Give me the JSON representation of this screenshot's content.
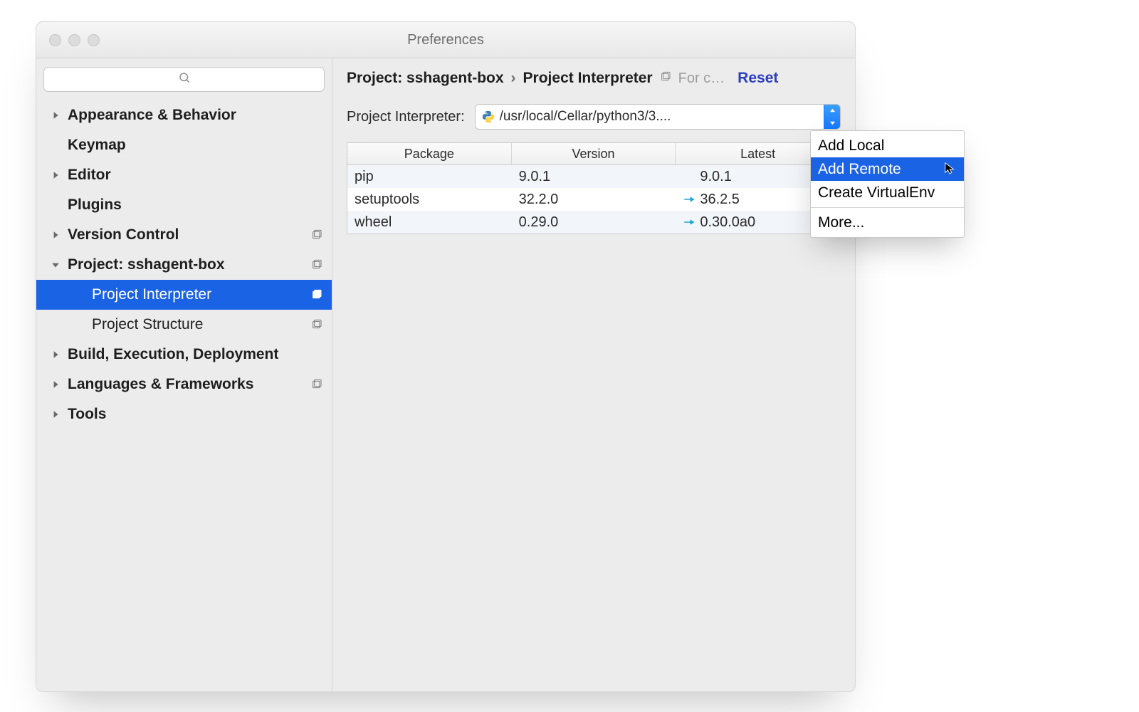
{
  "window": {
    "title": "Preferences"
  },
  "sidebar": {
    "search_placeholder": "",
    "items": [
      {
        "label": "Appearance & Behavior",
        "bold": true,
        "expandable": true,
        "expanded": false,
        "badge": false,
        "selected": false
      },
      {
        "label": "Keymap",
        "bold": true,
        "expandable": false,
        "expanded": false,
        "badge": false,
        "selected": false
      },
      {
        "label": "Editor",
        "bold": true,
        "expandable": true,
        "expanded": false,
        "badge": false,
        "selected": false
      },
      {
        "label": "Plugins",
        "bold": true,
        "expandable": false,
        "expanded": false,
        "badge": false,
        "selected": false
      },
      {
        "label": "Version Control",
        "bold": true,
        "expandable": true,
        "expanded": false,
        "badge": true,
        "selected": false
      },
      {
        "label": "Project: sshagent-box",
        "bold": true,
        "expandable": true,
        "expanded": true,
        "badge": true,
        "selected": false,
        "children": [
          {
            "label": "Project Interpreter",
            "badge": true,
            "selected": true
          },
          {
            "label": "Project Structure",
            "badge": true,
            "selected": false
          }
        ]
      },
      {
        "label": "Build, Execution, Deployment",
        "bold": true,
        "expandable": true,
        "expanded": false,
        "badge": false,
        "selected": false
      },
      {
        "label": "Languages & Frameworks",
        "bold": true,
        "expandable": true,
        "expanded": false,
        "badge": true,
        "selected": false
      },
      {
        "label": "Tools",
        "bold": true,
        "expandable": true,
        "expanded": false,
        "badge": false,
        "selected": false
      }
    ]
  },
  "breadcrumb": {
    "project": "Project: sshagent-box",
    "separator": "›",
    "page": "Project Interpreter",
    "for_current": "For c…",
    "reset": "Reset"
  },
  "interpreter": {
    "label": "Project Interpreter:",
    "value": "/usr/local/Cellar/python3/3...."
  },
  "table": {
    "columns": [
      "Package",
      "Version",
      "Latest"
    ],
    "rows": [
      {
        "package": "pip",
        "version": "9.0.1",
        "latest": "9.0.1",
        "update": false
      },
      {
        "package": "setuptools",
        "version": "32.2.0",
        "latest": "36.2.5",
        "update": true
      },
      {
        "package": "wheel",
        "version": "0.29.0",
        "latest": "0.30.0a0",
        "update": true
      }
    ]
  },
  "popup": {
    "items": [
      {
        "label": "Add Local",
        "highlight": false
      },
      {
        "label": "Add Remote",
        "highlight": true
      },
      {
        "label": "Create VirtualEnv",
        "highlight": false
      }
    ],
    "more": "More..."
  }
}
